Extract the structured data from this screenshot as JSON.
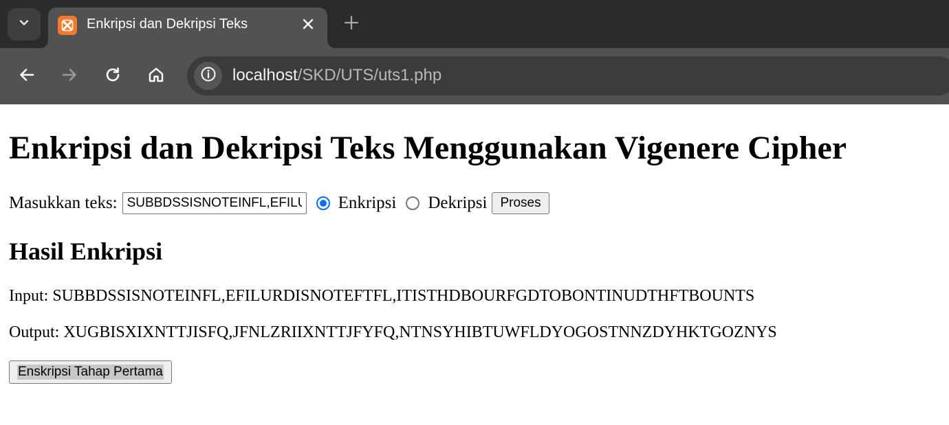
{
  "browser": {
    "tab": {
      "title": "Enkripsi dan Dekripsi Teks",
      "favicon": "xampp-icon"
    },
    "address_bar": {
      "host": "localhost",
      "path": "/SKD/UTS/uts1.php"
    },
    "icons": {
      "tab_search": "chevron-down-icon",
      "close_tab": "close-icon",
      "new_tab": "plus-icon",
      "back": "arrow-left-icon",
      "forward": "arrow-right-icon",
      "reload": "reload-icon",
      "home": "home-icon",
      "site_info": "info-icon"
    }
  },
  "page": {
    "title": "Enkripsi dan Dekripsi Teks Menggunakan Vigenere Cipher",
    "form": {
      "label": "Masukkan teks:",
      "text_value": "SUBBDSSISNOTEINFL,EFILURDISNOTEFTFL,ITISTHDBOURFGDTOBONTINUDTHFTBOUNTS",
      "options": [
        {
          "label": "Enkripsi",
          "checked": true
        },
        {
          "label": "Dekripsi",
          "checked": false
        }
      ],
      "submit_label": "Proses"
    },
    "result": {
      "heading": "Hasil Enkripsi",
      "input_line": "Input: SUBBDSSISNOTEINFL,EFILURDISNOTEFTFL,ITISTHDBOURFGDTOBONTINUDTHFTBOUNTS",
      "output_line": "Output: XUGBISXIXNTTJISFQ,JFNLZRIIXNTTJFYFQ,NTNSYHIBTUWFLDYOGOSTNNZDYHKTGOZNYS"
    },
    "stage_button_label": "Enskripsi Tahap Pertama"
  },
  "colors": {
    "tabstrip_bg": "#2b2b2b",
    "toolbar_bg": "#525252",
    "omnibox_bg": "#3b3b3b",
    "favicon": "#f37a2a",
    "radio_accent": "#0b6cf0"
  }
}
